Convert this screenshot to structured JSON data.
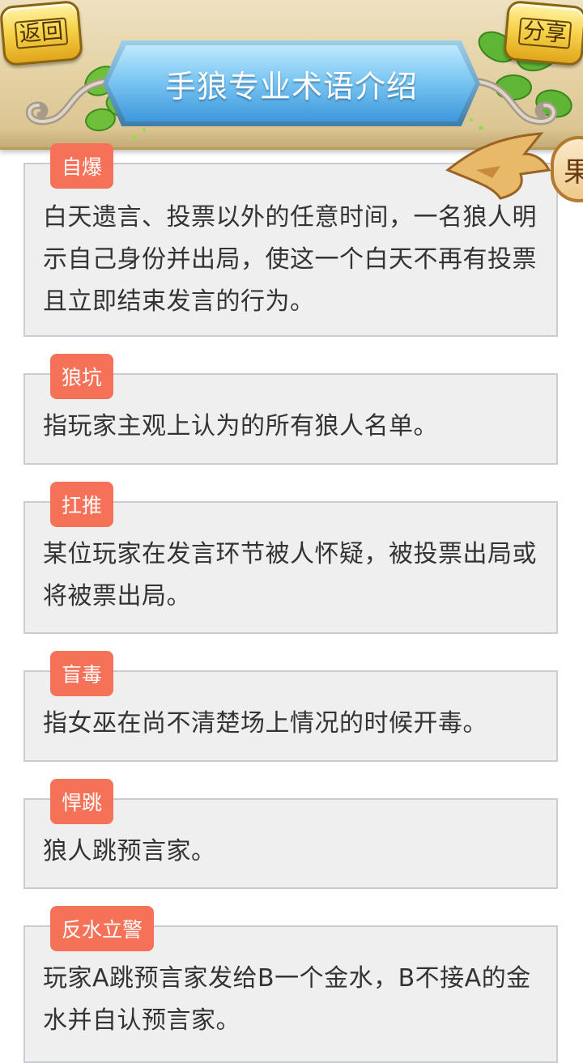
{
  "header": {
    "back_label": "返回",
    "share_label": "分享",
    "title": "手狼专业术语介绍",
    "side_tab_label": "果"
  },
  "terms": [
    {
      "tag": "自爆",
      "desc": "白天遗言、投票以外的任意时间，一名狼人明示自己身份并出局，使这一个白天不再有投票且立即结束发言的行为。"
    },
    {
      "tag": "狼坑",
      "desc": "指玩家主观上认为的所有狼人名单。"
    },
    {
      "tag": "扛推",
      "desc": "某位玩家在发言环节被人怀疑，被投票出局或将被票出局。"
    },
    {
      "tag": "盲毒",
      "desc": "指女巫在尚不清楚场上情况的时候开毒。"
    },
    {
      "tag": "悍跳",
      "desc": "狼人跳预言家。"
    },
    {
      "tag": "反水立警",
      "desc": "玩家A跳预言家发给B一个金水，B不接A的金水并自认预言家。"
    }
  ],
  "colors": {
    "tag_bg": "#f57158",
    "card_bg": "#efefef",
    "title_banner": "#5fb3ea",
    "header_bg": "#e2cf9f"
  }
}
